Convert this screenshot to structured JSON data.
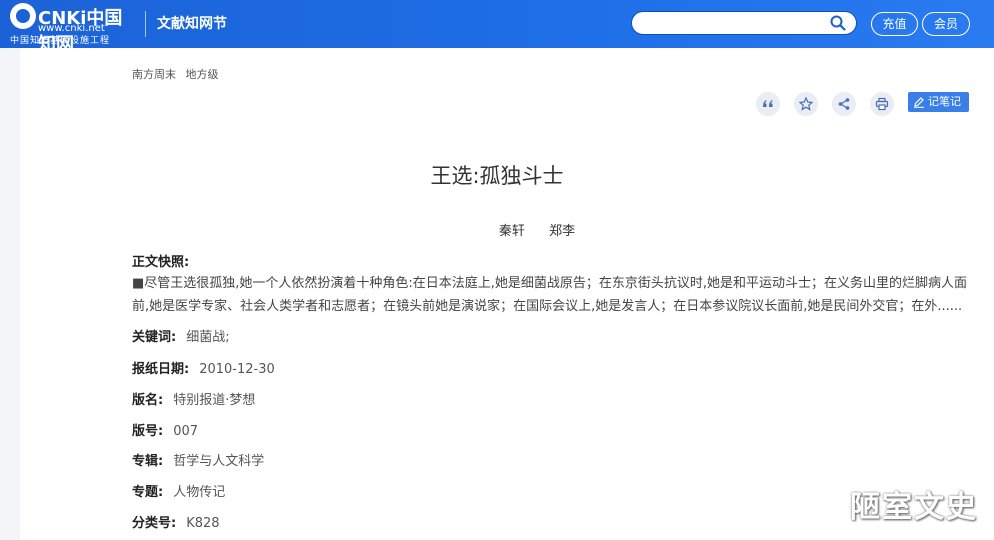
{
  "header": {
    "logo_cn": "CNKi中国知网",
    "logo_url": "www.cnki.net",
    "logo_sub": "中国知识基础设施工程",
    "section_title": "文献知网节",
    "search_placeholder": "",
    "recharge_label": "充值",
    "member_label": "会员"
  },
  "breadcrumb": {
    "source": "南方周末",
    "level": "地方级"
  },
  "toolbar": {
    "icons": [
      "quote-icon",
      "star-icon",
      "share-icon",
      "print-icon"
    ],
    "note_label": "记笔记"
  },
  "article": {
    "title": "王选:孤独斗士",
    "authors": [
      "秦轩",
      "郑李"
    ],
    "snapshot_label": "正文快照:",
    "snapshot_text": "■尽管王选很孤独,她一个人依然扮演着十种角色:在日本法庭上,她是细菌战原告；在东京街头抗议时,她是和平运动斗士；在义务山里的烂脚病人面前,她是医学专家、社会人类学者和志愿者；在镜头前她是演说家；在国际会议上,她是发言人；在日本参议院议长面前,她是民间外交官；在外......",
    "fields": [
      {
        "key": "关键词:",
        "value": "细菌战;"
      },
      {
        "key": "报纸日期:",
        "value": "2010-12-30"
      },
      {
        "key": "版名:",
        "value": "特别报道·梦想"
      },
      {
        "key": "版号:",
        "value": "007"
      },
      {
        "key": "专辑:",
        "value": "哲学与人文科学"
      },
      {
        "key": "专题:",
        "value": "人物传记"
      },
      {
        "key": "分类号:",
        "value": "K828"
      }
    ]
  },
  "watermark": "陋室文史",
  "colors": {
    "header_blue": "#1f6fe8",
    "note_button": "#3a7fe8"
  }
}
